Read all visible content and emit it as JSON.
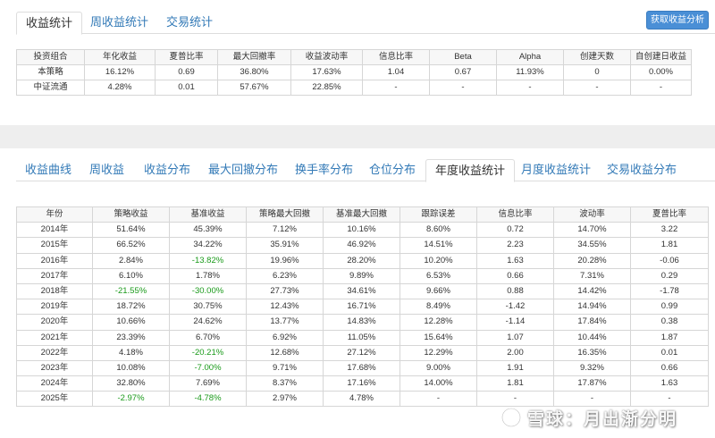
{
  "top_tabs": [
    {
      "label": "收益统计",
      "active": true
    },
    {
      "label": "周收益统计",
      "active": false
    },
    {
      "label": "交易统计",
      "active": false
    }
  ],
  "analysis_button": "获取收益分析",
  "summary": {
    "headers": [
      "投资组合",
      "年化收益",
      "夏普比率",
      "最大回撤率",
      "收益波动率",
      "信息比率",
      "Beta",
      "Alpha",
      "创建天数",
      "自创建日收益"
    ],
    "rows": [
      [
        "本策略",
        "16.12%",
        "0.69",
        "36.80%",
        "17.63%",
        "1.04",
        "0.67",
        "11.93%",
        "0",
        "0.00%"
      ],
      [
        "中证流通",
        "4.28%",
        "0.01",
        "57.67%",
        "22.85%",
        "-",
        "-",
        "-",
        "-",
        "-"
      ]
    ]
  },
  "bottom_tabs": [
    {
      "label": "收益曲线",
      "active": false
    },
    {
      "label": "周收益",
      "active": false
    },
    {
      "label": "收益分布",
      "active": false
    },
    {
      "label": "最大回撤分布",
      "active": false
    },
    {
      "label": "换手率分布",
      "active": false
    },
    {
      "label": "仓位分布",
      "active": false
    },
    {
      "label": "年度收益统计",
      "active": true
    },
    {
      "label": "月度收益统计",
      "active": false
    },
    {
      "label": "交易收益分布",
      "active": false
    }
  ],
  "annual": {
    "headers": [
      "年份",
      "策略收益",
      "基准收益",
      "策略最大回撤",
      "基准最大回撤",
      "跟踪误差",
      "信息比率",
      "波动率",
      "夏普比率"
    ],
    "rows": [
      [
        "2014年",
        "51.64%",
        "45.39%",
        "7.12%",
        "10.16%",
        "8.60%",
        "0.72",
        "14.70%",
        "3.22"
      ],
      [
        "2015年",
        "66.52%",
        "34.22%",
        "35.91%",
        "46.92%",
        "14.51%",
        "2.23",
        "34.55%",
        "1.81"
      ],
      [
        "2016年",
        "2.84%",
        "-13.82%",
        "19.96%",
        "28.20%",
        "10.20%",
        "1.63",
        "20.28%",
        "-0.06"
      ],
      [
        "2017年",
        "6.10%",
        "1.78%",
        "6.23%",
        "9.89%",
        "6.53%",
        "0.66",
        "7.31%",
        "0.29"
      ],
      [
        "2018年",
        "-21.55%",
        "-30.00%",
        "27.73%",
        "34.61%",
        "9.66%",
        "0.88",
        "14.42%",
        "-1.78"
      ],
      [
        "2019年",
        "18.72%",
        "30.75%",
        "12.43%",
        "16.71%",
        "8.49%",
        "-1.42",
        "14.94%",
        "0.99"
      ],
      [
        "2020年",
        "10.66%",
        "24.62%",
        "13.77%",
        "14.83%",
        "12.28%",
        "-1.14",
        "17.84%",
        "0.38"
      ],
      [
        "2021年",
        "23.39%",
        "6.70%",
        "6.92%",
        "11.05%",
        "15.64%",
        "1.07",
        "10.44%",
        "1.87"
      ],
      [
        "2022年",
        "4.18%",
        "-20.21%",
        "12.68%",
        "27.12%",
        "12.29%",
        "2.00",
        "16.35%",
        "0.01"
      ],
      [
        "2023年",
        "10.08%",
        "-7.00%",
        "9.71%",
        "17.68%",
        "9.00%",
        "1.91",
        "9.32%",
        "0.66"
      ],
      [
        "2024年",
        "32.80%",
        "7.69%",
        "8.37%",
        "17.16%",
        "14.00%",
        "1.81",
        "17.87%",
        "1.63"
      ],
      [
        "2025年",
        "-2.97%",
        "-4.78%",
        "2.97%",
        "4.78%",
        "-",
        "-",
        "-",
        "-"
      ]
    ]
  },
  "colors": {
    "link": "#337ab7",
    "negative": "#1a9a1a",
    "button": "#4a8fd6",
    "gap": "#eeeeee"
  },
  "watermark": "雪球：月出渐分明"
}
